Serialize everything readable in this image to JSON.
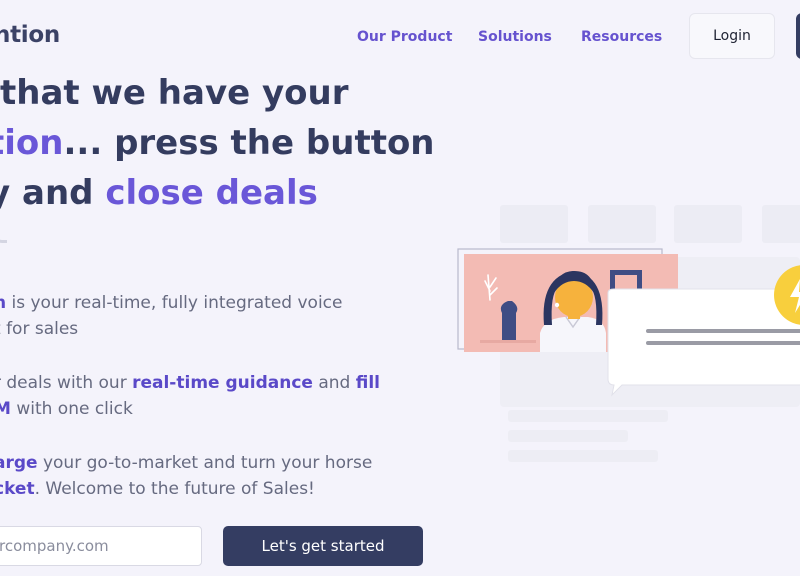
{
  "brand": {
    "logo_text": "ntion"
  },
  "nav": {
    "links": [
      "Our Product",
      "Solutions",
      "Resources"
    ],
    "login_label": "Login"
  },
  "hero": {
    "line1": "that we have your",
    "line2_accent": "tion",
    "line2_rest": "... press the button",
    "line3_pre": "y and ",
    "line3_accent": "close deals"
  },
  "features": [
    {
      "l1_b": "n",
      "l1_rest": " is your real-time, fully integrated voice",
      "l2": "t for sales"
    },
    {
      "l1_pre": "r deals with our ",
      "l1_b1": "real-time guidance",
      "l1_mid": " and ",
      "l1_b2": "fill",
      "l2_b": "M",
      "l2_rest": " with one click"
    },
    {
      "l1_b": "arge",
      "l1_rest": " your go-to-market and turn your horse",
      "l2_b": "cket",
      "l2_rest": ". Welcome to the future of Sales!"
    }
  ],
  "signup": {
    "email_placeholder": "rcompany.com",
    "cta_label": "Let's get started"
  },
  "colors": {
    "accent": "#6a57d8",
    "navy": "#343d62",
    "background": "#f4f3fb"
  },
  "icons": [
    "lightning-icon",
    "plant-vase-icon",
    "picture-frame-icon"
  ]
}
